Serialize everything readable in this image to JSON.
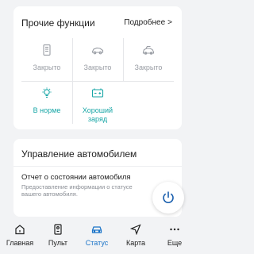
{
  "functions": {
    "title": "Прочие функции",
    "more_label": "Подробнее",
    "more_chevron": ">",
    "items": [
      {
        "label": "Закрыто",
        "icon": "door-panel-icon",
        "state": "inactive"
      },
      {
        "label": "Закрыто",
        "icon": "car-door-icon",
        "state": "inactive"
      },
      {
        "label": "Закрыто",
        "icon": "car-trunk-icon",
        "state": "inactive"
      },
      {
        "label": "В норме",
        "icon": "light-bulb-icon",
        "state": "ok"
      },
      {
        "label": "Хороший заряд",
        "icon": "battery-icon",
        "state": "ok"
      }
    ]
  },
  "manage": {
    "title": "Управление автомобилем",
    "report_title": "Отчет о состоянии автомобиля",
    "report_desc": "Предоставление информации о статусе вашего автомобиля."
  },
  "tabs": [
    {
      "label": "Главная",
      "icon": "home-icon",
      "active": false
    },
    {
      "label": "Пульт",
      "icon": "remote-icon",
      "active": false
    },
    {
      "label": "Статус",
      "icon": "car-icon",
      "active": true
    },
    {
      "label": "Карта",
      "icon": "navigation-arrow-icon",
      "active": false
    },
    {
      "label": "Еще",
      "icon": "more-dots-icon",
      "active": false
    }
  ],
  "colors": {
    "accent": "#1a73c8",
    "ok_teal": "#17a6a6",
    "inactive_gray": "#9a9ea5",
    "background": "#f2f3f5"
  }
}
